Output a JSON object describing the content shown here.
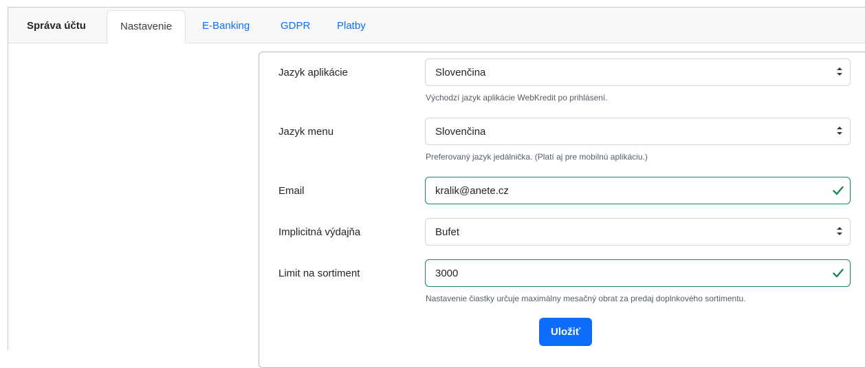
{
  "tabs": {
    "title": "Správa účtu",
    "items": [
      {
        "label": "Nastavenie",
        "active": true
      },
      {
        "label": "E-Banking"
      },
      {
        "label": "GDPR"
      },
      {
        "label": "Platby"
      }
    ]
  },
  "form": {
    "app_language": {
      "label": "Jazyk aplikácie",
      "value": "Slovenčina",
      "help": "Východzí jazyk aplikácie WebKredit po prihlásení."
    },
    "menu_language": {
      "label": "Jazyk menu",
      "value": "Slovenčina",
      "help": "Preferovaný jazyk jedálnička. (Platí aj pre mobilnú aplikáciu.)"
    },
    "email": {
      "label": "Email",
      "value": "kralik@anete.cz"
    },
    "default_outlet": {
      "label": "Implicitná výdajňa",
      "value": "Bufet"
    },
    "assortment_limit": {
      "label": "Limit na sortiment",
      "value": "3000",
      "help": "Nastavenie čiastky určuje maximálny mesačný obrat za predaj doplnkového sortimentu."
    },
    "save_label": "Uložiť"
  },
  "icons": {
    "select_arrow": "sort-arrows-icon",
    "valid": "check-icon"
  },
  "colors": {
    "accent": "#0d6efd",
    "valid": "#198754"
  }
}
